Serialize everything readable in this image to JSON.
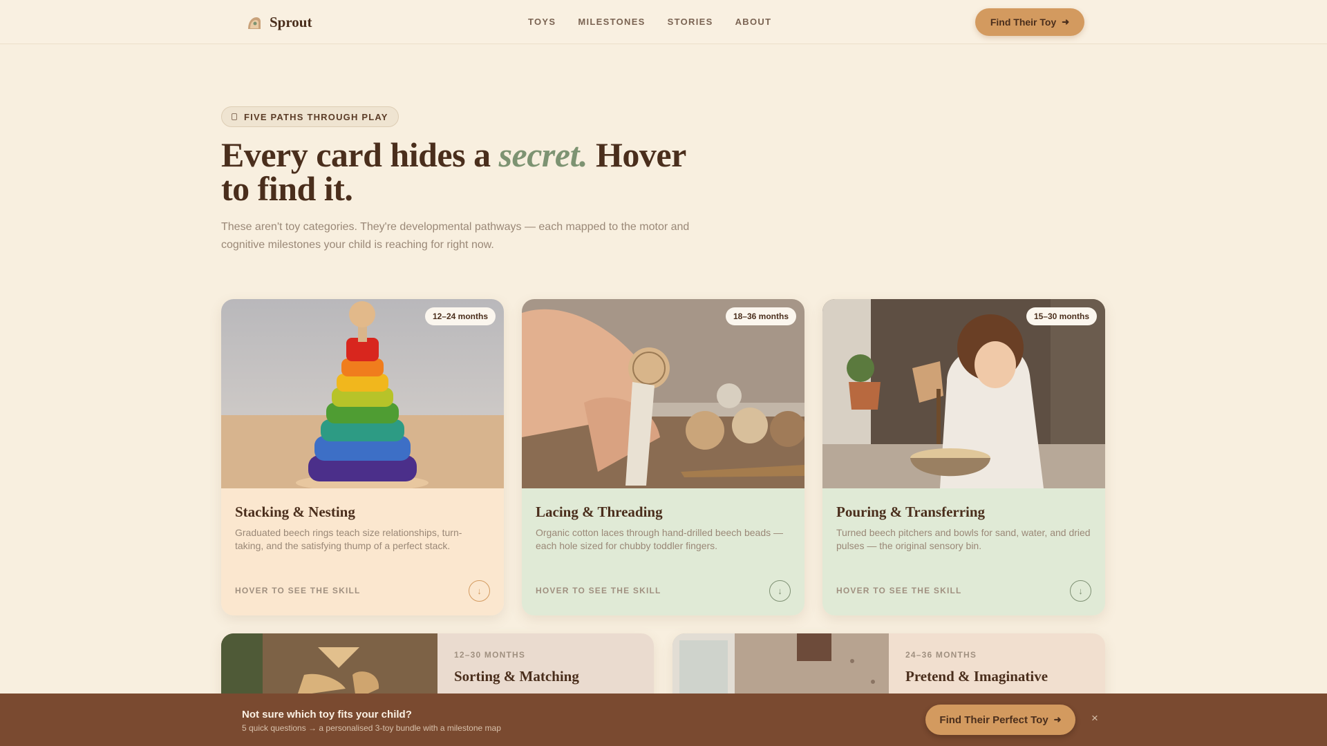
{
  "header": {
    "brand": "Sprout",
    "nav": [
      "TOYS",
      "MILESTONES",
      "STORIES",
      "ABOUT"
    ],
    "cta_label": "Find Their Toy"
  },
  "hero": {
    "pill_label": "FIVE PATHS THROUGH PLAY",
    "title_before": "Every card hides a ",
    "title_emphasis": "secret.",
    "title_after": " Hover to find it.",
    "subtitle": "These aren't toy categories. They're developmental pathways — each mapped to the motor and cognitive milestones your child is reaching for right now."
  },
  "cards": [
    {
      "age": "12–24 months",
      "title": "Stacking & Nesting",
      "desc": "Graduated beech rings teach size relationships, turn-taking, and the satisfying thump of a perfect stack.",
      "foot": "HOVER TO SEE THE SKILL"
    },
    {
      "age": "18–36 months",
      "title": "Lacing & Threading",
      "desc": "Organic cotton laces through hand-drilled beech beads — each hole sized for chubby toddler fingers.",
      "foot": "HOVER TO SEE THE SKILL"
    },
    {
      "age": "15–30 months",
      "title": "Pouring & Transferring",
      "desc": "Turned beech pitchers and bowls for sand, water, and dried pulses — the original sensory bin.",
      "foot": "HOVER TO SEE THE SKILL"
    }
  ],
  "wide_cards": [
    {
      "age": "12–30 MONTHS",
      "title": "Sorting & Matching"
    },
    {
      "age": "24–36 MONTHS",
      "title": "Pretend & Imaginative"
    }
  ],
  "bottom_bar": {
    "title": "Not sure which toy fits your child?",
    "subtitle": "5 quick questions → a personalised 3-toy bundle with a milestone map",
    "cta_label": "Find Their Perfect Toy",
    "close": "×"
  },
  "colors": {
    "background": "#f8efdf",
    "accent": "#d39a5f",
    "text_dark": "#4a2e1c",
    "sage": "#7d9372",
    "bar": "#7a4a30"
  },
  "icons": [
    "sprout-logo-icon",
    "arrow-right-icon",
    "tag-icon",
    "arrow-down-circle-icon",
    "close-icon"
  ]
}
